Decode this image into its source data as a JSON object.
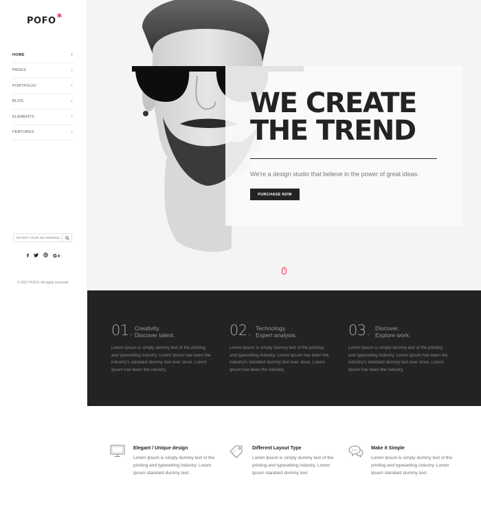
{
  "sidebar": {
    "logo": "POFO",
    "logo_mark": "*",
    "menu": [
      {
        "label": "HOME"
      },
      {
        "label": "PAGES"
      },
      {
        "label": "PORTFOLIO"
      },
      {
        "label": "BLOG"
      },
      {
        "label": "ELEMENTS"
      },
      {
        "label": "FEATURES"
      }
    ],
    "search_placeholder": "ENTER YOUR KEYWORDS...",
    "social": [
      {
        "icon": "facebook-icon",
        "glyph": "f"
      },
      {
        "icon": "twitter-icon",
        "glyph": "t"
      },
      {
        "icon": "dribbble-icon",
        "glyph": "⊕"
      },
      {
        "icon": "google-plus-icon",
        "glyph": "G+"
      }
    ],
    "copyright": "© 2017 POFO. All rights reserved"
  },
  "hero": {
    "headline_line1": "WE CREATE",
    "headline_line2": "THE TREND",
    "subtext": "We're a design studio that believe in the power of great ideas.",
    "cta_label": "PURCHASE NOW"
  },
  "features_dark": [
    {
      "num": "01.",
      "line1": "Creativity.",
      "line2": "Discover talent.",
      "desc": "Lorem Ipsum is simply dummy text of the printing and typesetting industry. Lorem Ipsum has been the industry's standard dummy text ever since. Lorem Ipsum has been the industry."
    },
    {
      "num": "02.",
      "line1": "Technology.",
      "line2": "Expert analysis.",
      "desc": "Lorem Ipsum is simply dummy text of the printing and typesetting industry. Lorem Ipsum has been the industry's standard dummy text ever since. Lorem Ipsum has been the industry."
    },
    {
      "num": "03.",
      "line1": "Discover.",
      "line2": "Explore work.",
      "desc": "Lorem Ipsum is simply dummy text of the printing and typesetting industry. Lorem Ipsum has been the industry's standard dummy text ever since. Lorem Ipsum has been the industry."
    }
  ],
  "features_light": [
    {
      "icon": "monitor-icon",
      "title": "Elegant / Unique design",
      "desc": "Lorem Ipsum is simply dummy text of the printing and typesetting industry. Lorem Ipsum standard dummy text."
    },
    {
      "icon": "tags-icon",
      "title": "Different Layout Type",
      "desc": "Lorem Ipsum is simply dummy text of the printing and typesetting industry. Lorem Ipsum standard dummy text."
    },
    {
      "icon": "chat-bubbles-icon",
      "title": "Make it Simple",
      "desc": "Lorem Ipsum is simply dummy text of the printing and typesetting industry. Lorem Ipsum standard dummy text."
    }
  ],
  "colors": {
    "accent": "#ff214f",
    "dark": "#232323",
    "hero_bg": "#f4f4f4"
  }
}
